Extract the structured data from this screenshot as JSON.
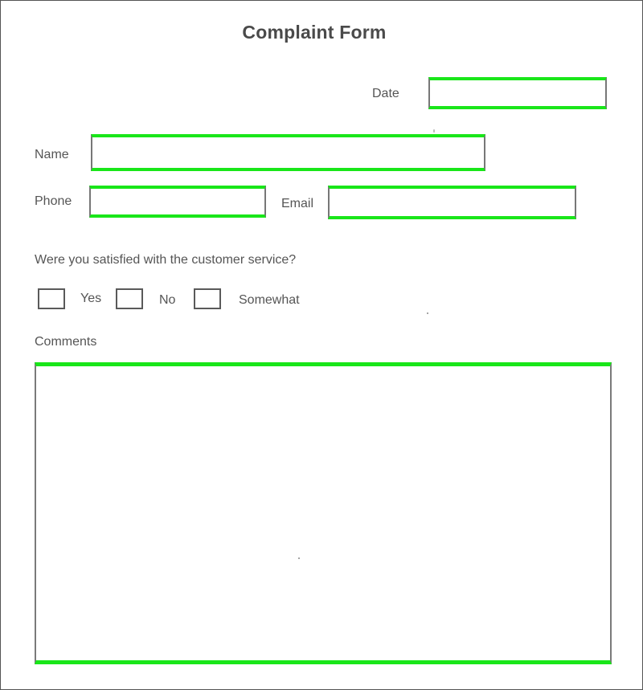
{
  "form": {
    "title": "Complaint Form",
    "date_label": "Date",
    "date_value": "",
    "name_label": "Name",
    "name_value": "",
    "phone_label": "Phone",
    "phone_value": "",
    "email_label": "Email",
    "email_value": "",
    "question": "Were you satisfied with the customer service?",
    "options": [
      {
        "label": "Yes",
        "checked": false
      },
      {
        "label": "No",
        "checked": false
      },
      {
        "label": "Somewhat",
        "checked": false
      }
    ],
    "comments_label": "Comments",
    "comments_value": ""
  },
  "colors": {
    "field_highlight": "#19e619",
    "text": "#555555",
    "frame": "#555555"
  }
}
